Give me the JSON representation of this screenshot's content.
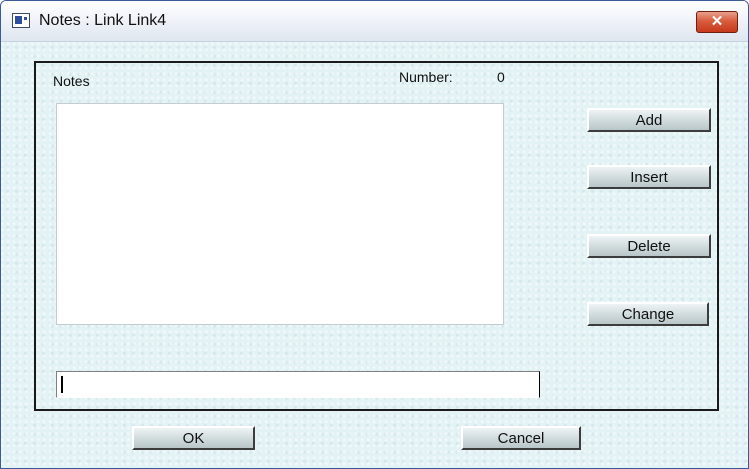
{
  "window": {
    "title": "Notes : Link Link4",
    "close_glyph": "✕"
  },
  "panel": {
    "notes_label": "Notes",
    "number_label": "Number:",
    "number_value": "0",
    "notes_items": [],
    "input_value": ""
  },
  "side_buttons": {
    "add": "Add",
    "insert": "Insert",
    "delete": "Delete",
    "change": "Change"
  },
  "footer_buttons": {
    "ok": "OK",
    "cancel": "Cancel"
  },
  "icons": {
    "app": "window-app-icon",
    "close": "close-icon"
  },
  "colors": {
    "close_button": "#d14a2a",
    "background": "#e3f2f4"
  }
}
